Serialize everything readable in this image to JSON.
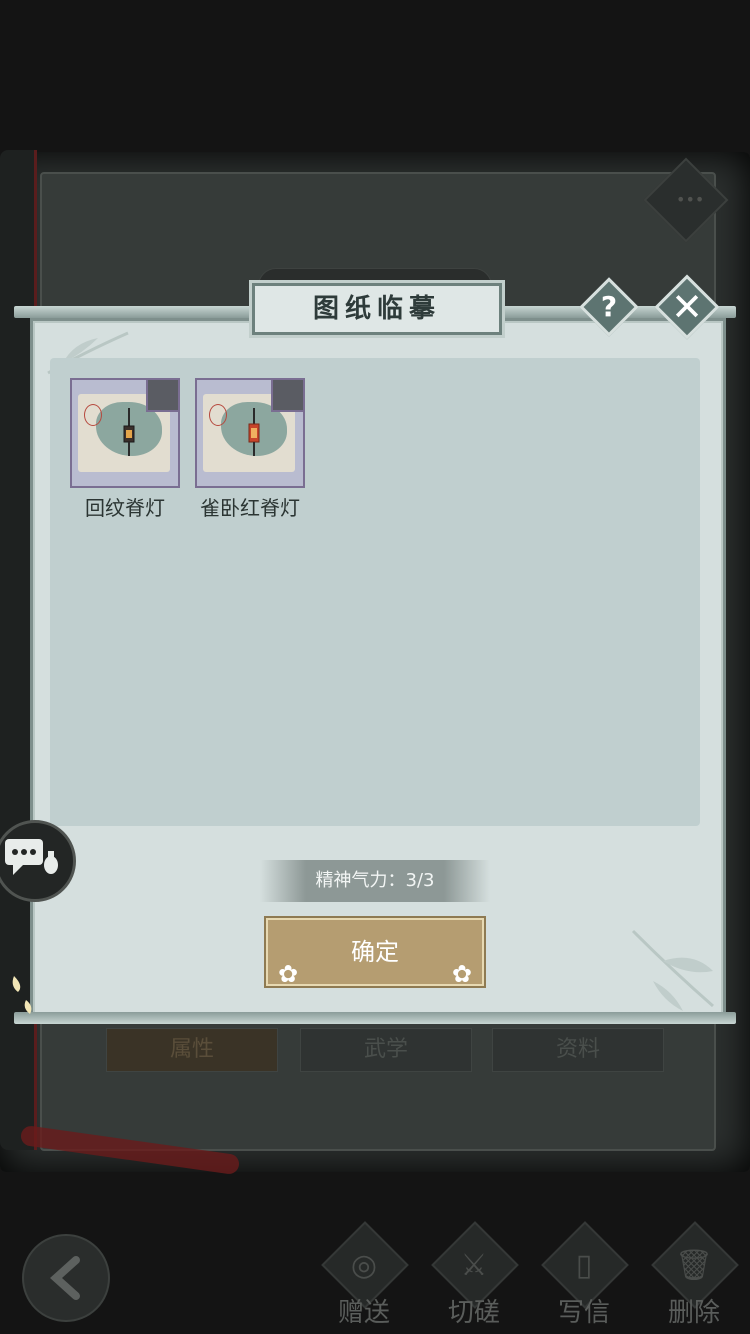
{
  "dialog": {
    "title": "图纸临摹",
    "help_symbol": "?",
    "close_symbol": "✕",
    "items": [
      {
        "name": "回纹脊灯",
        "lamp_color": "#3a2f2a"
      },
      {
        "name": "雀卧红脊灯",
        "lamp_color": "#c8452b"
      }
    ],
    "spirit_label": "精神气力：3/3",
    "confirm_label": "确定"
  },
  "background": {
    "tabs": [
      "属性",
      "武学",
      "资料"
    ],
    "bottom_nav": [
      {
        "label": "赠送",
        "icon": "scroll-icon"
      },
      {
        "label": "切磋",
        "icon": "sword-icon"
      },
      {
        "label": "写信",
        "icon": "letter-icon"
      },
      {
        "label": "删除",
        "icon": "trash-icon"
      }
    ]
  },
  "colors": {
    "panel_bg": "#d5dfde",
    "confirm_button": "#b59d71",
    "accent_teal": "#5d7471"
  }
}
